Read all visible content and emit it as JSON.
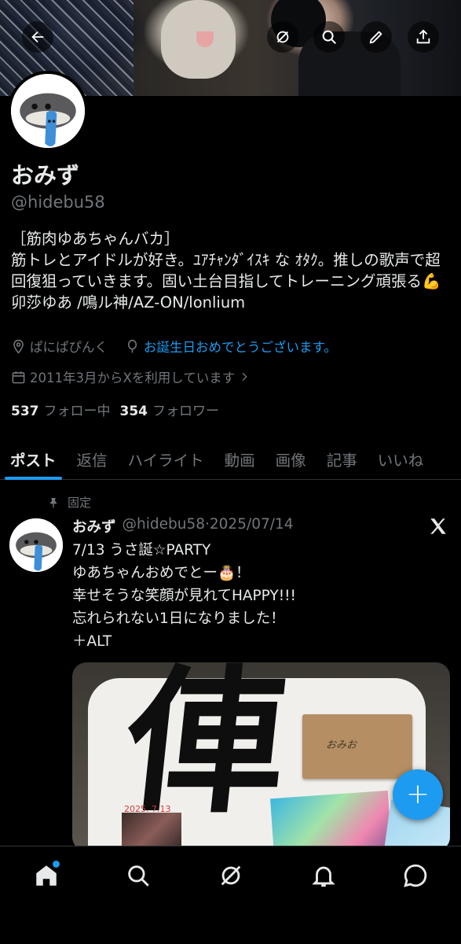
{
  "profile": {
    "display_name": "おみず",
    "handle": "@hidebu58",
    "bio": "［筋肉ゆあちゃんバカ］\n筋トレとアイドルが好き。ﾕｱﾁｬﾝﾀﾞｲｽｷ な ｵﾀｸ。推しの歌声で超回復狙っていきます。固い土台目指してトレーニング頑張る💪卯莎ゆあ /鳴ル神/AZ-ON/lonlium",
    "location": "ぱにぱぴんく",
    "birthday_text": "お誕生日おめでとうございます。",
    "joined": "2011年3月からXを利用しています",
    "following_count": "537",
    "following_label": "フォロー中",
    "followers_count": "354",
    "followers_label": "フォロワー"
  },
  "tabs": [
    "ポスト",
    "返信",
    "ハイライト",
    "動画",
    "画像",
    "記事",
    "いいね"
  ],
  "active_tab": "ポスト",
  "pinned_post": {
    "pinned_label": "固定",
    "author_name": "おみず",
    "author_handle": "@hidebu58",
    "date": "·2025/07/14",
    "text": "7/13 うさ誕☆PARTY\nゆあちゃんおめでとー🎂！\n幸せそうな笑顔が見れてHAPPY!!!\n忘れられない1日になりました！\n＋ALT",
    "media": {
      "card_text": "おみお",
      "photo_date": "2025. 7.13"
    }
  },
  "fab": {
    "label": "+"
  },
  "colors": {
    "accent": "#1d9bf0",
    "background": "#000000",
    "secondary_text": "#71767b",
    "primary_text": "#e7e9ea"
  },
  "icons": [
    "back-icon",
    "grok-icon",
    "search-icon",
    "edit-icon",
    "share-icon",
    "location-icon",
    "balloon-icon",
    "calendar-icon",
    "chevron-right-icon",
    "pin-icon",
    "x-logo-icon",
    "home-icon",
    "explore-icon",
    "grok-nav-icon",
    "notifications-icon",
    "messages-icon"
  ]
}
